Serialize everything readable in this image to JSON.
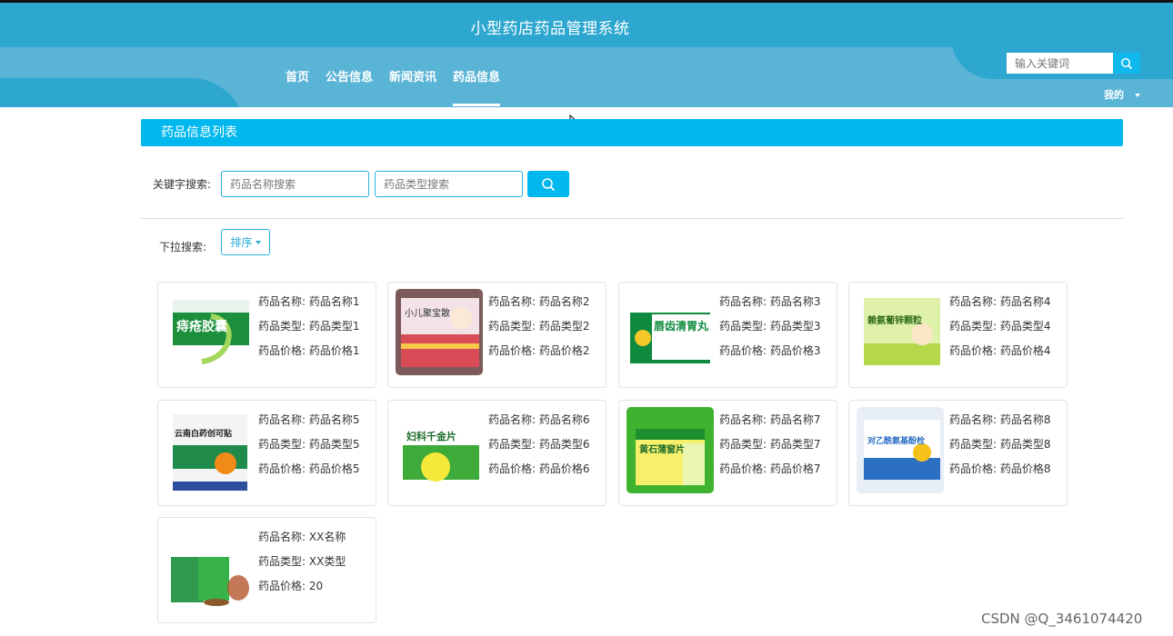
{
  "header": {
    "site_title": "小型药店药品管理系统",
    "nav": [
      "首页",
      "公告信息",
      "新闻资讯",
      "药品信息"
    ],
    "active_nav": "药品信息",
    "search_placeholder": "输入关键词",
    "user_menu": "我的"
  },
  "main": {
    "section_title": "药品信息列表",
    "keyword_label": "关键字搜索:",
    "name_placeholder": "药品名称搜索",
    "type_placeholder": "药品类型搜索",
    "dropdown_label": "下拉搜索:",
    "sort_label": "排序"
  },
  "labels": {
    "name": "药品名称:",
    "type": "药品类型:",
    "price": "药品价格:"
  },
  "drugs": [
    {
      "name": "药品名称1",
      "type": "药品类型1",
      "price": "药品价格1"
    },
    {
      "name": "药品名称2",
      "type": "药品类型2",
      "price": "药品价格2"
    },
    {
      "name": "药品名称3",
      "type": "药品类型3",
      "price": "药品价格3"
    },
    {
      "name": "药品名称4",
      "type": "药品类型4",
      "price": "药品价格4"
    },
    {
      "name": "药品名称5",
      "type": "药品类型5",
      "price": "药品价格5"
    },
    {
      "name": "药品名称6",
      "type": "药品类型6",
      "price": "药品价格6"
    },
    {
      "name": "药品名称7",
      "type": "药品类型7",
      "price": "药品价格7"
    },
    {
      "name": "药品名称8",
      "type": "药品类型8",
      "price": "药品价格8"
    },
    {
      "name": "XX名称",
      "type": "XX类型",
      "price": "20"
    }
  ],
  "product_images": [
    {
      "brand_text": "痔疮胶囊"
    },
    {
      "brand_text": "小儿聚宝散"
    },
    {
      "brand_text": "唇齿清胃丸"
    },
    {
      "brand_text": "赖氨葡锌颗粒"
    },
    {
      "brand_text": "云南白药创可贴"
    },
    {
      "brand_text": "妇科千金片"
    },
    {
      "brand_text": "黄石蒲窗片"
    },
    {
      "brand_text": "对乙酰氨基酚栓"
    },
    {
      "brand_text": ""
    }
  ],
  "watermark": "CSDN @Q_3461074420"
}
